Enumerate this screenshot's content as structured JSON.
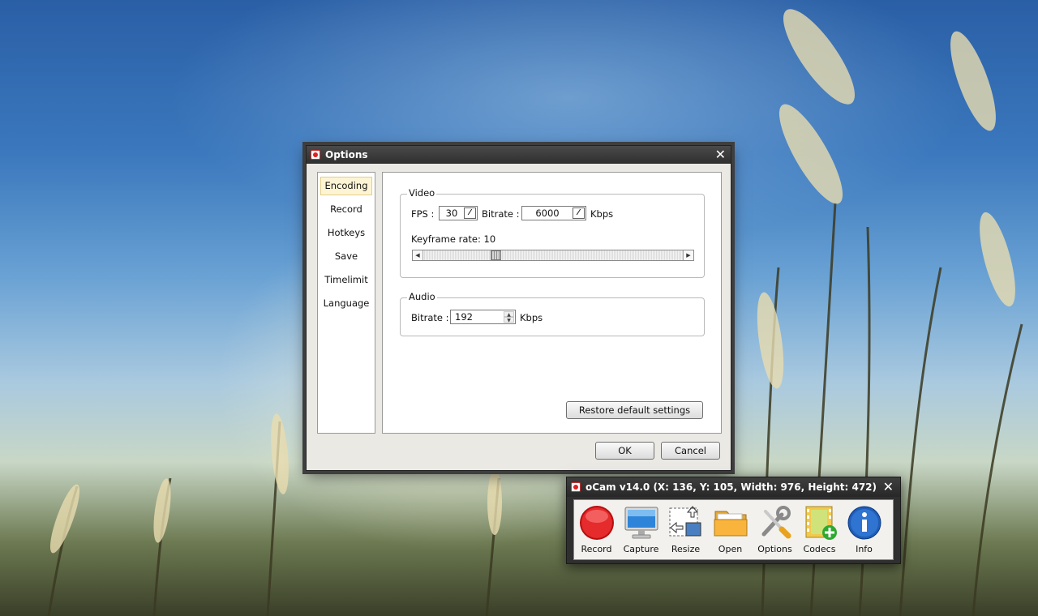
{
  "options_window": {
    "title": "Options",
    "sidebar": [
      {
        "label": "Encoding",
        "active": true
      },
      {
        "label": "Record",
        "active": false
      },
      {
        "label": "Hotkeys",
        "active": false
      },
      {
        "label": "Save",
        "active": false
      },
      {
        "label": "Timelimit",
        "active": false
      },
      {
        "label": "Language",
        "active": false
      }
    ],
    "video": {
      "title": "Video",
      "fps_label": "FPS :",
      "fps_value": "30",
      "bitrate_label": "Bitrate :",
      "bitrate_value": "6000",
      "bitrate_unit": "Kbps",
      "keyframe_label": "Keyframe rate:",
      "keyframe_value": "10",
      "keyframe_level": 0.27
    },
    "audio": {
      "title": "Audio",
      "bitrate_label": "Bitrate :",
      "bitrate_value": "192",
      "bitrate_unit": "Kbps"
    },
    "restore_label": "Restore default settings",
    "ok_label": "OK",
    "cancel_label": "Cancel"
  },
  "ocam": {
    "title": "oCam v14.0 (X: 136, Y: 105, Width: 976, Height: 472)",
    "tools": [
      {
        "label": "Record",
        "icon": "record-icon"
      },
      {
        "label": "Capture",
        "icon": "monitor-icon"
      },
      {
        "label": "Resize",
        "icon": "resize-icon"
      },
      {
        "label": "Open",
        "icon": "folder-icon"
      },
      {
        "label": "Options",
        "icon": "tools-icon"
      },
      {
        "label": "Codecs",
        "icon": "film-add-icon"
      },
      {
        "label": "Info",
        "icon": "info-icon"
      }
    ]
  },
  "colors": {
    "sidebar_active_bg": "#fdf4d4",
    "titlebar": "#2f2f2f",
    "record_red": "#d81818",
    "info_blue": "#1f5db8"
  }
}
